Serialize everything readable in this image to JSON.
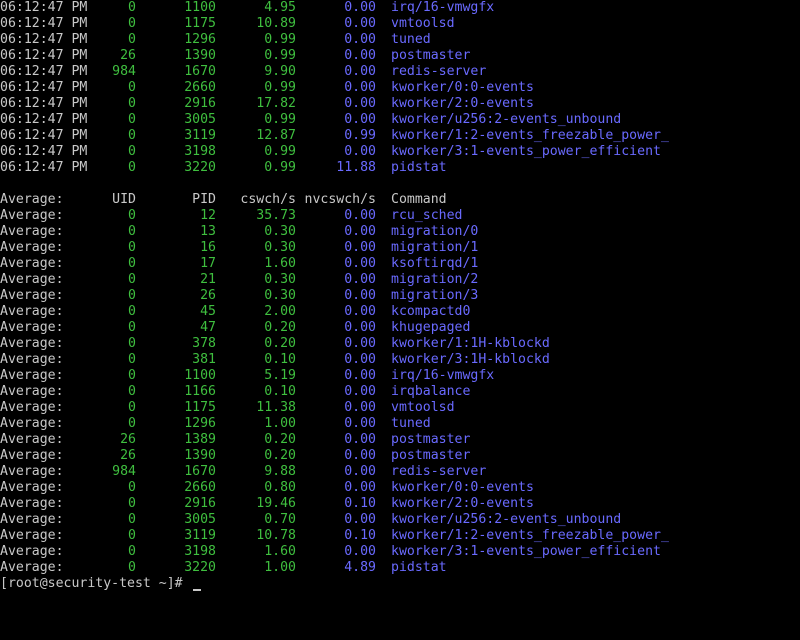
{
  "colors": {
    "background": "#000000",
    "text": "#c8c8c8",
    "green": "#3fbf3f",
    "blue": "#6a6aff"
  },
  "terminal": {
    "rows": [
      {
        "time": "06:12:47 PM",
        "uid": "0",
        "pid": "1100",
        "cswch": "4.95",
        "nvcswch": "0.00",
        "command": "irq/16-vmwgfx"
      },
      {
        "time": "06:12:47 PM",
        "uid": "0",
        "pid": "1175",
        "cswch": "10.89",
        "nvcswch": "0.00",
        "command": "vmtoolsd"
      },
      {
        "time": "06:12:47 PM",
        "uid": "0",
        "pid": "1296",
        "cswch": "0.99",
        "nvcswch": "0.00",
        "command": "tuned"
      },
      {
        "time": "06:12:47 PM",
        "uid": "26",
        "pid": "1390",
        "cswch": "0.99",
        "nvcswch": "0.00",
        "command": "postmaster"
      },
      {
        "time": "06:12:47 PM",
        "uid": "984",
        "pid": "1670",
        "cswch": "9.90",
        "nvcswch": "0.00",
        "command": "redis-server"
      },
      {
        "time": "06:12:47 PM",
        "uid": "0",
        "pid": "2660",
        "cswch": "0.99",
        "nvcswch": "0.00",
        "command": "kworker/0:0-events"
      },
      {
        "time": "06:12:47 PM",
        "uid": "0",
        "pid": "2916",
        "cswch": "17.82",
        "nvcswch": "0.00",
        "command": "kworker/2:0-events"
      },
      {
        "time": "06:12:47 PM",
        "uid": "0",
        "pid": "3005",
        "cswch": "0.99",
        "nvcswch": "0.00",
        "command": "kworker/u256:2-events_unbound"
      },
      {
        "time": "06:12:47 PM",
        "uid": "0",
        "pid": "3119",
        "cswch": "12.87",
        "nvcswch": "0.99",
        "command": "kworker/1:2-events_freezable_power_"
      },
      {
        "time": "06:12:47 PM",
        "uid": "0",
        "pid": "3198",
        "cswch": "0.99",
        "nvcswch": "0.00",
        "command": "kworker/3:1-events_power_efficient"
      },
      {
        "time": "06:12:47 PM",
        "uid": "0",
        "pid": "3220",
        "cswch": "0.99",
        "nvcswch": "11.88",
        "command": "pidstat"
      }
    ],
    "header": {
      "time": "Average:",
      "uid": "UID",
      "pid": "PID",
      "cswch": "cswch/s",
      "nvcswch": "nvcswch/s",
      "command": "Command"
    },
    "average_rows": [
      {
        "time": "Average:",
        "uid": "0",
        "pid": "12",
        "cswch": "35.73",
        "nvcswch": "0.00",
        "command": "rcu_sched"
      },
      {
        "time": "Average:",
        "uid": "0",
        "pid": "13",
        "cswch": "0.30",
        "nvcswch": "0.00",
        "command": "migration/0"
      },
      {
        "time": "Average:",
        "uid": "0",
        "pid": "16",
        "cswch": "0.30",
        "nvcswch": "0.00",
        "command": "migration/1"
      },
      {
        "time": "Average:",
        "uid": "0",
        "pid": "17",
        "cswch": "1.60",
        "nvcswch": "0.00",
        "command": "ksoftirqd/1"
      },
      {
        "time": "Average:",
        "uid": "0",
        "pid": "21",
        "cswch": "0.30",
        "nvcswch": "0.00",
        "command": "migration/2"
      },
      {
        "time": "Average:",
        "uid": "0",
        "pid": "26",
        "cswch": "0.30",
        "nvcswch": "0.00",
        "command": "migration/3"
      },
      {
        "time": "Average:",
        "uid": "0",
        "pid": "45",
        "cswch": "2.00",
        "nvcswch": "0.00",
        "command": "kcompactd0"
      },
      {
        "time": "Average:",
        "uid": "0",
        "pid": "47",
        "cswch": "0.20",
        "nvcswch": "0.00",
        "command": "khugepaged"
      },
      {
        "time": "Average:",
        "uid": "0",
        "pid": "378",
        "cswch": "0.20",
        "nvcswch": "0.00",
        "command": "kworker/1:1H-kblockd"
      },
      {
        "time": "Average:",
        "uid": "0",
        "pid": "381",
        "cswch": "0.10",
        "nvcswch": "0.00",
        "command": "kworker/3:1H-kblockd"
      },
      {
        "time": "Average:",
        "uid": "0",
        "pid": "1100",
        "cswch": "5.19",
        "nvcswch": "0.00",
        "command": "irq/16-vmwgfx"
      },
      {
        "time": "Average:",
        "uid": "0",
        "pid": "1166",
        "cswch": "0.10",
        "nvcswch": "0.00",
        "command": "irqbalance"
      },
      {
        "time": "Average:",
        "uid": "0",
        "pid": "1175",
        "cswch": "11.38",
        "nvcswch": "0.00",
        "command": "vmtoolsd"
      },
      {
        "time": "Average:",
        "uid": "0",
        "pid": "1296",
        "cswch": "1.00",
        "nvcswch": "0.00",
        "command": "tuned"
      },
      {
        "time": "Average:",
        "uid": "26",
        "pid": "1389",
        "cswch": "0.20",
        "nvcswch": "0.00",
        "command": "postmaster"
      },
      {
        "time": "Average:",
        "uid": "26",
        "pid": "1390",
        "cswch": "0.20",
        "nvcswch": "0.00",
        "command": "postmaster"
      },
      {
        "time": "Average:",
        "uid": "984",
        "pid": "1670",
        "cswch": "9.88",
        "nvcswch": "0.00",
        "command": "redis-server"
      },
      {
        "time": "Average:",
        "uid": "0",
        "pid": "2660",
        "cswch": "0.80",
        "nvcswch": "0.00",
        "command": "kworker/0:0-events"
      },
      {
        "time": "Average:",
        "uid": "0",
        "pid": "2916",
        "cswch": "19.46",
        "nvcswch": "0.10",
        "command": "kworker/2:0-events"
      },
      {
        "time": "Average:",
        "uid": "0",
        "pid": "3005",
        "cswch": "0.70",
        "nvcswch": "0.00",
        "command": "kworker/u256:2-events_unbound"
      },
      {
        "time": "Average:",
        "uid": "0",
        "pid": "3119",
        "cswch": "10.78",
        "nvcswch": "0.10",
        "command": "kworker/1:2-events_freezable_power_"
      },
      {
        "time": "Average:",
        "uid": "0",
        "pid": "3198",
        "cswch": "1.60",
        "nvcswch": "0.00",
        "command": "kworker/3:1-events_power_efficient"
      },
      {
        "time": "Average:",
        "uid": "0",
        "pid": "3220",
        "cswch": "1.00",
        "nvcswch": "4.89",
        "command": "pidstat"
      }
    ],
    "prompt": "[root@security-test ~]# "
  }
}
